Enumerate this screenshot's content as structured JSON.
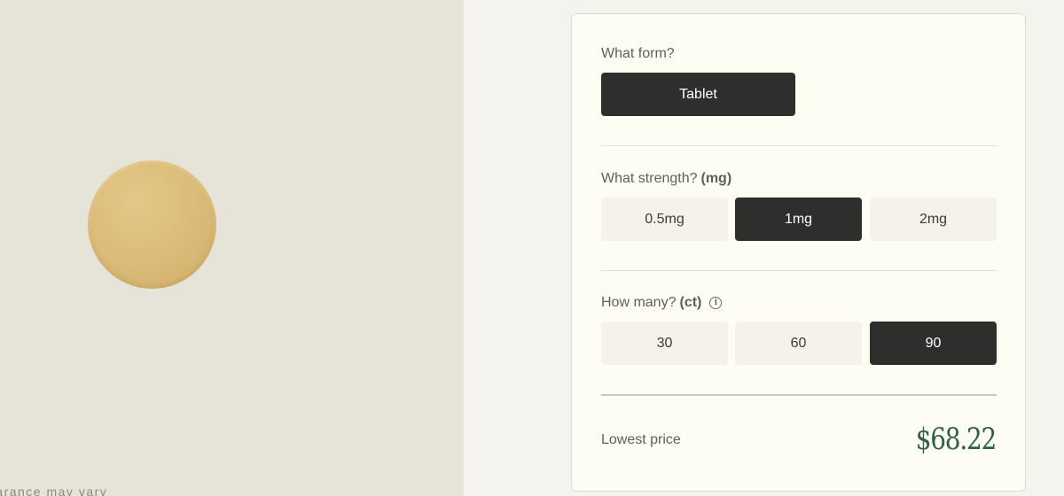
{
  "image_panel": {
    "disclaimer": "earance may vary"
  },
  "form": {
    "label": "What form?",
    "options": [
      {
        "label": "Tablet",
        "selected": true
      }
    ]
  },
  "strength": {
    "label": "What strength?",
    "unit": "(mg)",
    "options": [
      {
        "label": "0.5mg",
        "selected": false
      },
      {
        "label": "1mg",
        "selected": true
      },
      {
        "label": "2mg",
        "selected": false
      }
    ]
  },
  "quantity": {
    "label": "How many?",
    "unit": "(ct)",
    "info_icon": "info-icon",
    "options": [
      {
        "label": "30",
        "selected": false
      },
      {
        "label": "60",
        "selected": false
      },
      {
        "label": "90",
        "selected": true
      }
    ]
  },
  "price": {
    "label": "Lowest price",
    "value": "$68.22"
  },
  "colors": {
    "selected_bg": "#2e2e2d",
    "unselected_bg": "#f4f2ea",
    "price_color": "#2f5f47",
    "pill_color": "#dcbd7a"
  }
}
